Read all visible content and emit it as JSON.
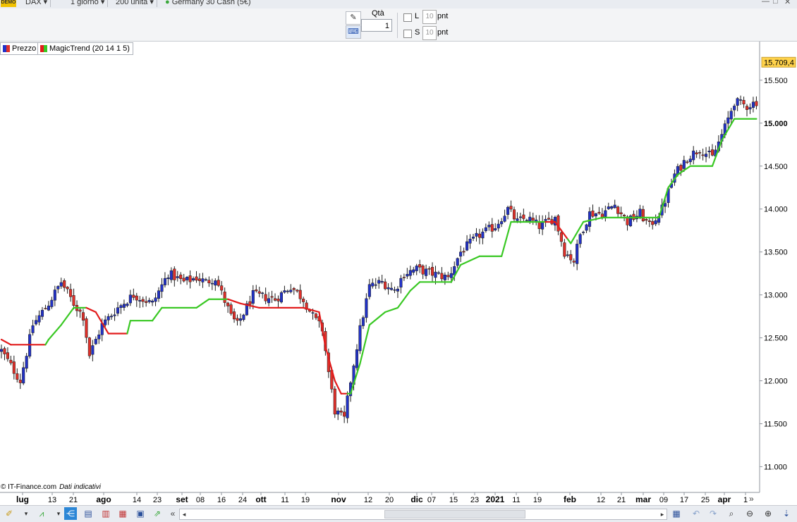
{
  "topbar": {
    "demo_badge": "DEMO",
    "symbol": "DAX",
    "timeframe": "1 giorno",
    "units": "200 unità",
    "instrument": "Germany 30 Cash (5€)"
  },
  "order": {
    "qty_label": "Qtà",
    "qty_value": "1",
    "long_label": "L",
    "short_label": "S",
    "pnt_value": "10",
    "pnt_label": "pnt"
  },
  "legend": {
    "price_label": "Prezzo",
    "indicator_label": "MagicTrend (20 14 1 5)"
  },
  "footer": {
    "source": "© IT-Finance.com",
    "note": "Dati indicativi"
  },
  "colors": {
    "up_candle": "#2232c8",
    "down_candle": "#e0302a",
    "trend_up": "#39c823",
    "trend_down": "#e21b1b",
    "last_price_bg": "#ffd24a"
  },
  "chart_data": {
    "type": "candlestick",
    "title": "",
    "xlabel": "",
    "ylabel": "",
    "ylim": [
      10700,
      15950
    ],
    "yticks": [
      11000,
      11500,
      12000,
      12500,
      13000,
      13500,
      14000,
      14500,
      15000,
      15500
    ],
    "ytick_labels": [
      "11.000",
      "11.500",
      "12.000",
      "12.500",
      "13.000",
      "13.500",
      "14.000",
      "14.500",
      "15.000",
      "15.500"
    ],
    "bold_ytick": "15.000",
    "last_price": 15709.4,
    "last_price_label": "15.709,4",
    "xticks": [
      {
        "label": "lug",
        "bold": true
      },
      {
        "label": "13"
      },
      {
        "label": "21"
      },
      {
        "label": "ago",
        "bold": true
      },
      {
        "label": "14"
      },
      {
        "label": "23"
      },
      {
        "label": "set",
        "bold": true
      },
      {
        "label": "08"
      },
      {
        "label": "16"
      },
      {
        "label": "24"
      },
      {
        "label": "ott",
        "bold": true
      },
      {
        "label": "11"
      },
      {
        "label": "19"
      },
      {
        "label": "nov",
        "bold": true
      },
      {
        "label": "12"
      },
      {
        "label": "20"
      },
      {
        "label": "dic",
        "bold": true
      },
      {
        "label": "07"
      },
      {
        "label": "15"
      },
      {
        "label": "23"
      },
      {
        "label": "2021",
        "bold": true
      },
      {
        "label": "11"
      },
      {
        "label": "19"
      },
      {
        "label": "feb",
        "bold": true
      },
      {
        "label": "12"
      },
      {
        "label": "21"
      },
      {
        "label": "mar",
        "bold": true
      },
      {
        "label": "09"
      },
      {
        "label": "17"
      },
      {
        "label": "25"
      },
      {
        "label": "apr",
        "bold": true
      },
      {
        "label": "1"
      }
    ],
    "price_anchors": [
      [
        0,
        12350
      ],
      [
        6,
        12000
      ],
      [
        10,
        12650
      ],
      [
        15,
        12900
      ],
      [
        19,
        13150
      ],
      [
        23,
        12900
      ],
      [
        26,
        12750
      ],
      [
        28,
        12300
      ],
      [
        32,
        12650
      ],
      [
        37,
        12850
      ],
      [
        42,
        13000
      ],
      [
        48,
        12900
      ],
      [
        53,
        13250
      ],
      [
        58,
        13150
      ],
      [
        62,
        13200
      ],
      [
        65,
        13150
      ],
      [
        68,
        13200
      ],
      [
        73,
        12750
      ],
      [
        75,
        12650
      ],
      [
        80,
        13000
      ],
      [
        87,
        12950
      ],
      [
        92,
        13100
      ],
      [
        96,
        12950
      ],
      [
        99,
        12750
      ],
      [
        102,
        12600
      ],
      [
        104,
        12100
      ],
      [
        106,
        11650
      ],
      [
        109,
        11550
      ],
      [
        111,
        12000
      ],
      [
        114,
        12600
      ],
      [
        117,
        13100
      ],
      [
        121,
        13150
      ],
      [
        125,
        13050
      ],
      [
        128,
        13250
      ],
      [
        132,
        13300
      ],
      [
        137,
        13250
      ],
      [
        142,
        13200
      ],
      [
        146,
        13500
      ],
      [
        152,
        13700
      ],
      [
        157,
        13800
      ],
      [
        161,
        14000
      ],
      [
        164,
        13850
      ],
      [
        167,
        13900
      ],
      [
        171,
        13800
      ],
      [
        176,
        13900
      ],
      [
        179,
        13500
      ],
      [
        182,
        13400
      ],
      [
        184,
        13700
      ],
      [
        187,
        13950
      ],
      [
        191,
        13950
      ],
      [
        195,
        14050
      ],
      [
        199,
        13850
      ],
      [
        203,
        13950
      ],
      [
        206,
        13800
      ],
      [
        210,
        14000
      ],
      [
        214,
        14400
      ],
      [
        218,
        14600
      ],
      [
        222,
        14700
      ],
      [
        226,
        14600
      ],
      [
        230,
        14950
      ],
      [
        233,
        15250
      ],
      [
        237,
        15200
      ],
      [
        240,
        15250
      ]
    ],
    "trend_anchors": [
      [
        0,
        12480,
        "d"
      ],
      [
        3,
        12420,
        "d"
      ],
      [
        14,
        12420,
        "d"
      ],
      [
        15,
        12480,
        "u"
      ],
      [
        19,
        12650,
        "u"
      ],
      [
        23,
        12850,
        "u"
      ],
      [
        27,
        12850,
        "u"
      ],
      [
        30,
        12800,
        "d"
      ],
      [
        34,
        12550,
        "d"
      ],
      [
        40,
        12550,
        "d"
      ],
      [
        41,
        12700,
        "u"
      ],
      [
        48,
        12700,
        "u"
      ],
      [
        51,
        12850,
        "u"
      ],
      [
        62,
        12850,
        "u"
      ],
      [
        66,
        12950,
        "u"
      ],
      [
        72,
        12950,
        "u"
      ],
      [
        76,
        12900,
        "d"
      ],
      [
        82,
        12850,
        "d"
      ],
      [
        96,
        12850,
        "d"
      ],
      [
        101,
        12800,
        "d"
      ],
      [
        103,
        12400,
        "d"
      ],
      [
        106,
        12000,
        "d"
      ],
      [
        108,
        11850,
        "d"
      ],
      [
        110,
        11850,
        "d"
      ],
      [
        111,
        11850,
        "u"
      ],
      [
        114,
        12200,
        "u"
      ],
      [
        117,
        12650,
        "u"
      ],
      [
        122,
        12800,
        "u"
      ],
      [
        126,
        12850,
        "u"
      ],
      [
        130,
        13050,
        "u"
      ],
      [
        133,
        13150,
        "u"
      ],
      [
        143,
        13150,
        "u"
      ],
      [
        146,
        13350,
        "u"
      ],
      [
        152,
        13450,
        "u"
      ],
      [
        159,
        13450,
        "u"
      ],
      [
        162,
        13850,
        "u"
      ],
      [
        173,
        13850,
        "u"
      ],
      [
        176,
        13850,
        "d"
      ],
      [
        180,
        13650,
        "d"
      ],
      [
        181,
        13600,
        "u"
      ],
      [
        185,
        13850,
        "u"
      ],
      [
        191,
        13900,
        "u"
      ],
      [
        198,
        13900,
        "u"
      ],
      [
        209,
        13900,
        "u"
      ],
      [
        212,
        14250,
        "u"
      ],
      [
        215,
        14400,
        "u"
      ],
      [
        219,
        14500,
        "u"
      ],
      [
        226,
        14500,
        "u"
      ],
      [
        229,
        14800,
        "u"
      ],
      [
        233,
        15050,
        "u"
      ],
      [
        240,
        15050,
        "u"
      ]
    ]
  }
}
